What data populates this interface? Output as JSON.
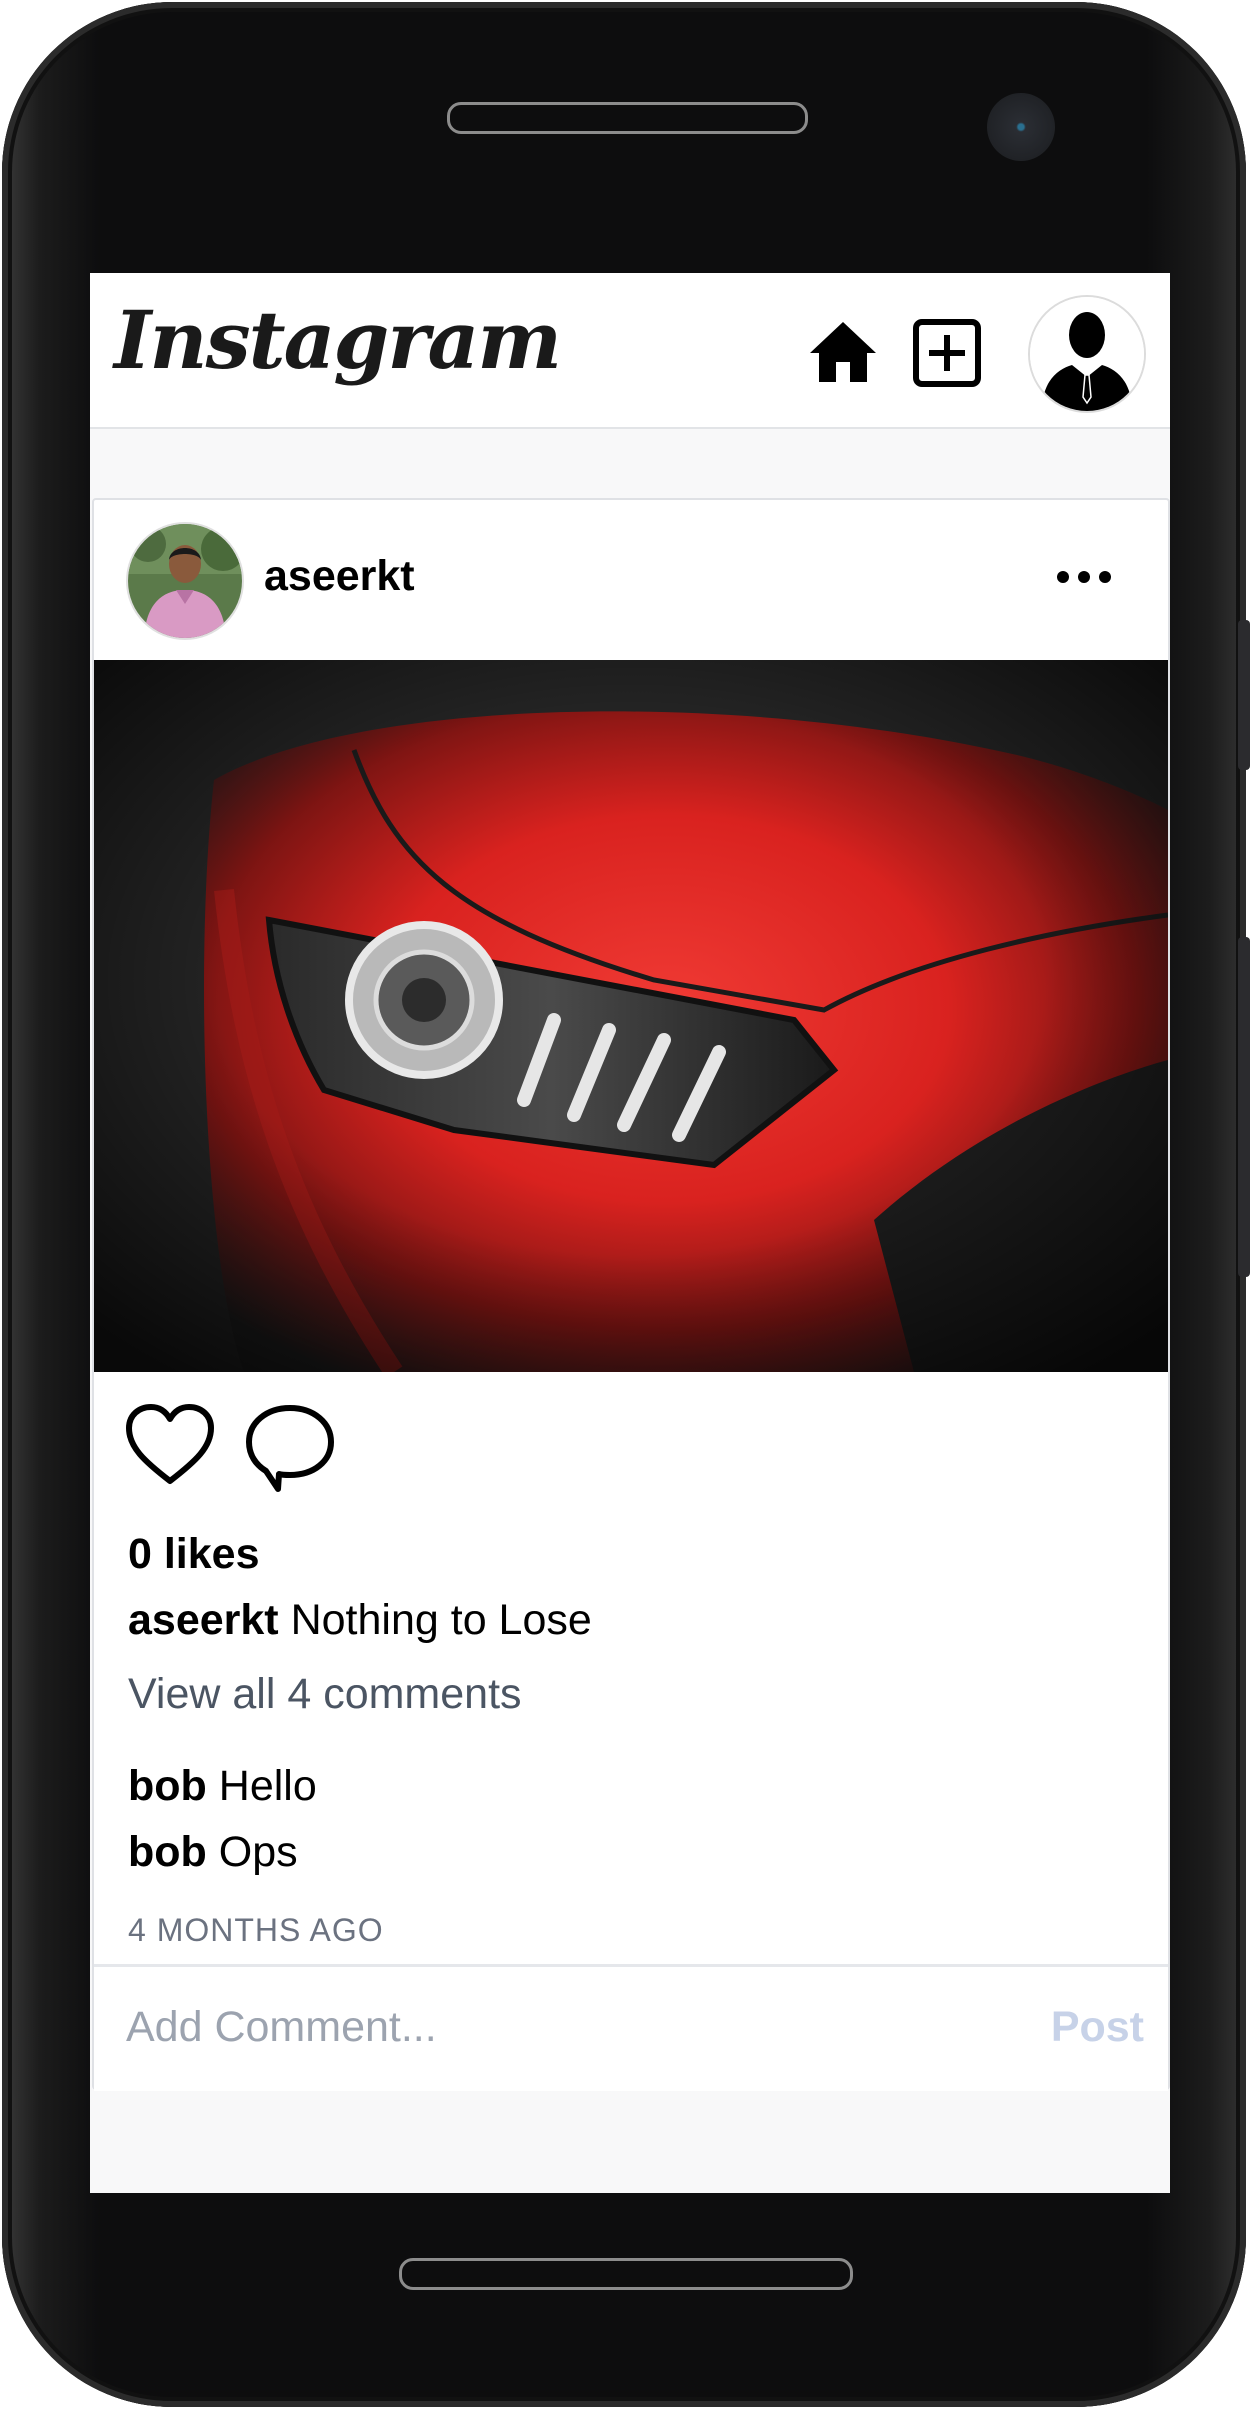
{
  "app": {
    "logo_text": "Instagram"
  },
  "nav": {
    "icons": [
      "home-icon",
      "add-post-icon",
      "profile-avatar-icon"
    ]
  },
  "post": {
    "username": "aseerkt",
    "likes_text": "0 likes",
    "caption_user": "aseerkt",
    "caption_text": " Nothing to Lose",
    "view_all_comments": "View all 4 comments",
    "comments": [
      {
        "user": "bob",
        "text": " Hello"
      },
      {
        "user": "bob",
        "text": " Ops"
      }
    ],
    "timestamp": "4 MONTHS AGO",
    "comment_placeholder": "Add Comment...",
    "post_button": "Post"
  },
  "colors": {
    "accent_disabled": "#c7d2e8",
    "muted_text": "#4b5563",
    "car_red": "#e8322f"
  }
}
